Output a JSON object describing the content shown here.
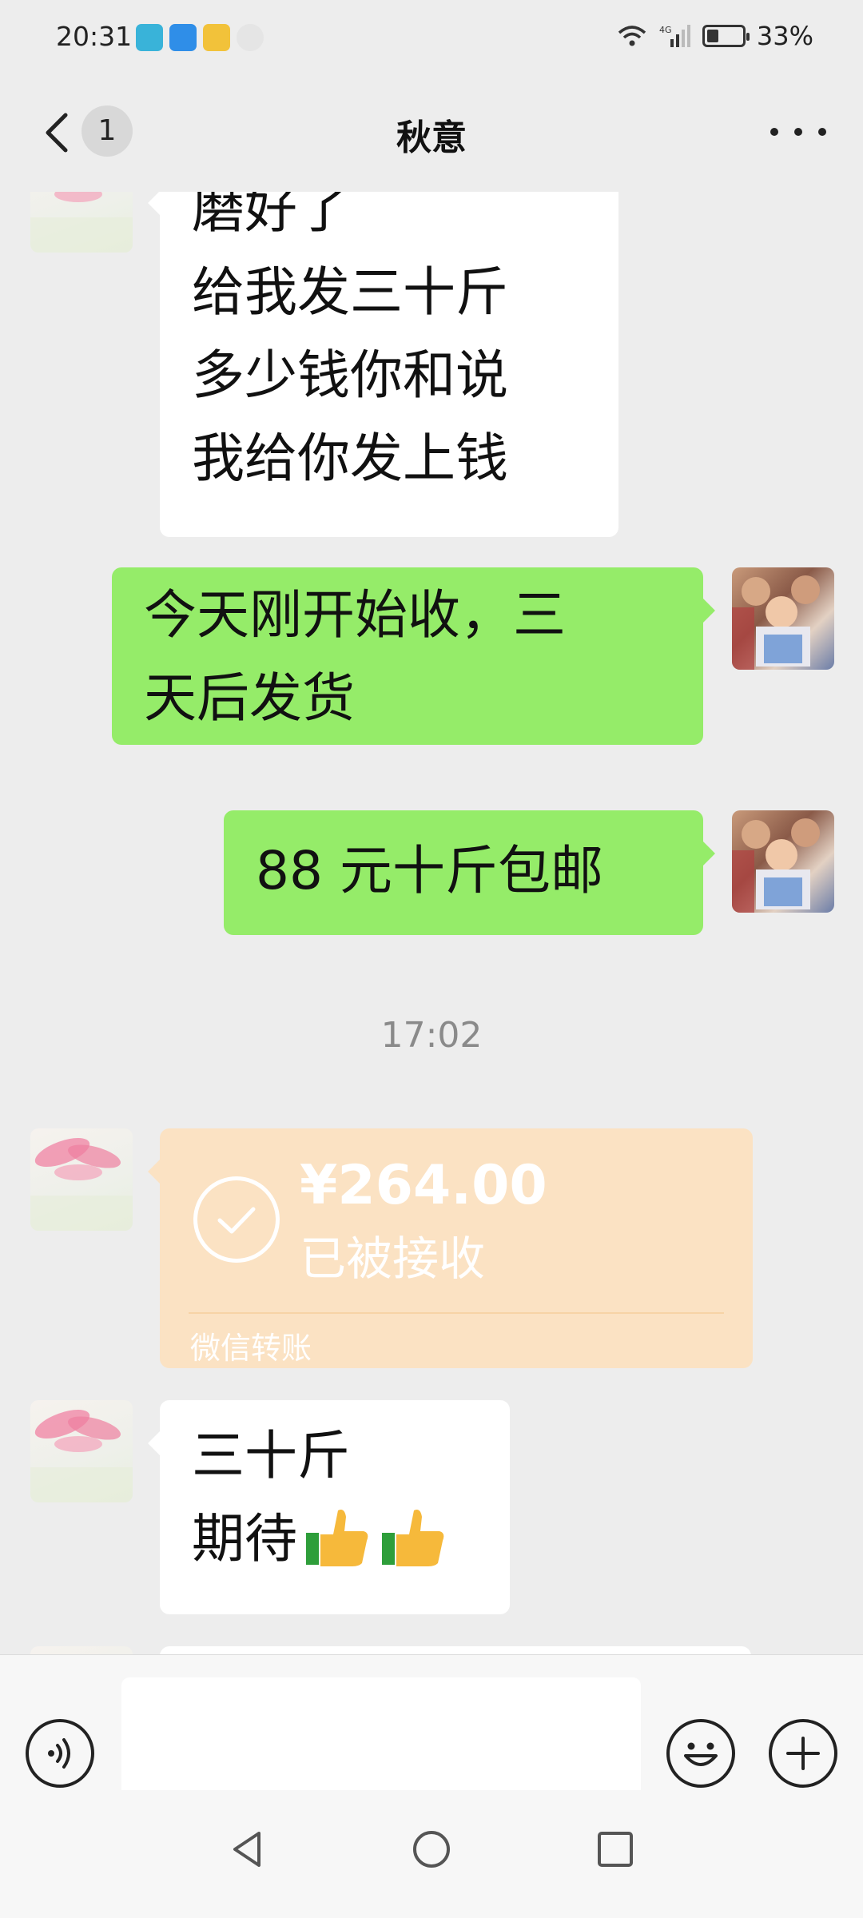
{
  "status_bar": {
    "time": "20:31",
    "battery_percent": "33%",
    "battery_level": 0.33,
    "icons": [
      "app-notification-icons",
      "wifi-icon",
      "signal-4g-icon",
      "battery-icon"
    ]
  },
  "nav": {
    "back_badge": "1",
    "title": "秋意",
    "more_icon": "more-dots-icon"
  },
  "messages": [
    {
      "side": "other",
      "text": "磨好了\n给我发三十斤\n多少钱你和说\n我给你发上钱"
    },
    {
      "side": "me",
      "text": "今天刚开始收，三\n天后发货"
    },
    {
      "side": "me",
      "text": "88 元十斤包邮"
    }
  ],
  "time_separator": "17:02",
  "transfer": {
    "amount": "¥264.00",
    "status": "已被接收",
    "label": "微信转账"
  },
  "last_message": {
    "line1": "三十斤",
    "line2": "期待"
  },
  "input_bar": {
    "placeholder": "",
    "voice_icon": "voice-icon",
    "emoji_icon": "emoji-icon",
    "plus_icon": "plus-icon"
  },
  "system_nav": [
    "back-triangle-icon",
    "home-circle-icon",
    "recents-square-icon"
  ],
  "colors": {
    "background": "#ededed",
    "my_bubble": "#95ec69",
    "other_bubble": "#ffffff",
    "transfer_card": "#fbe2c3"
  }
}
